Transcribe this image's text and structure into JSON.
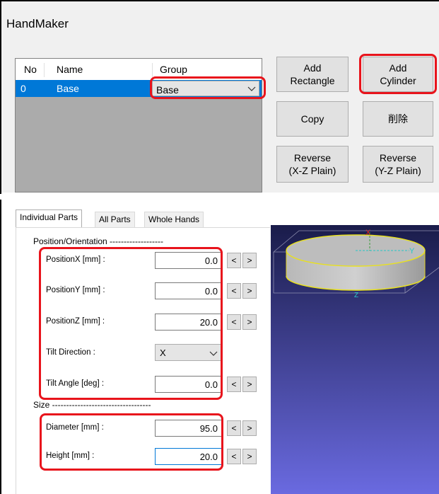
{
  "window": {
    "title": "HandMaker"
  },
  "parts_list": {
    "columns": [
      "No",
      "Name",
      "Group"
    ],
    "rows": [
      {
        "no": "0",
        "name": "Base",
        "group": "Base"
      }
    ]
  },
  "buttons": {
    "add_rectangle": [
      "Add",
      "Rectangle"
    ],
    "add_cylinder": [
      "Add",
      "Cylinder"
    ],
    "copy": "Copy",
    "delete": "削除",
    "reverse_xz": [
      "Reverse",
      "(X-Z Plain)"
    ],
    "reverse_yz": [
      "Reverse",
      "(Y-Z Plain)"
    ]
  },
  "tabs": [
    "Individual Parts",
    "All Parts",
    "Whole Hands"
  ],
  "position_section": {
    "title": "Position/Orientation -------------------",
    "position_x": {
      "label": "PositionX [mm] :",
      "value": "0.0"
    },
    "position_y": {
      "label": "PositionY [mm] :",
      "value": "0.0"
    },
    "position_z": {
      "label": "PositionZ [mm] :",
      "value": "20.0"
    },
    "tilt_direction": {
      "label": "Tilt Direction :",
      "value": "X"
    },
    "tilt_angle": {
      "label": "Tilt Angle [deg] :",
      "value": "0.0"
    }
  },
  "size_section": {
    "title": "Size -----------------------------------",
    "diameter": {
      "label": "Diameter [mm] :",
      "value": "95.0"
    },
    "height": {
      "label": "Height [mm] :",
      "value": "20.0"
    }
  },
  "stepper": {
    "decrement": "<",
    "increment": ">"
  },
  "viewport": {
    "axis_x": "X",
    "axis_y": "Y",
    "axis_z": "Z"
  },
  "colors": {
    "highlight": "#e8141c",
    "selection": "#0078d7",
    "viewport_top": "#1a1c4a",
    "viewport_bottom": "#6a6ae0"
  }
}
